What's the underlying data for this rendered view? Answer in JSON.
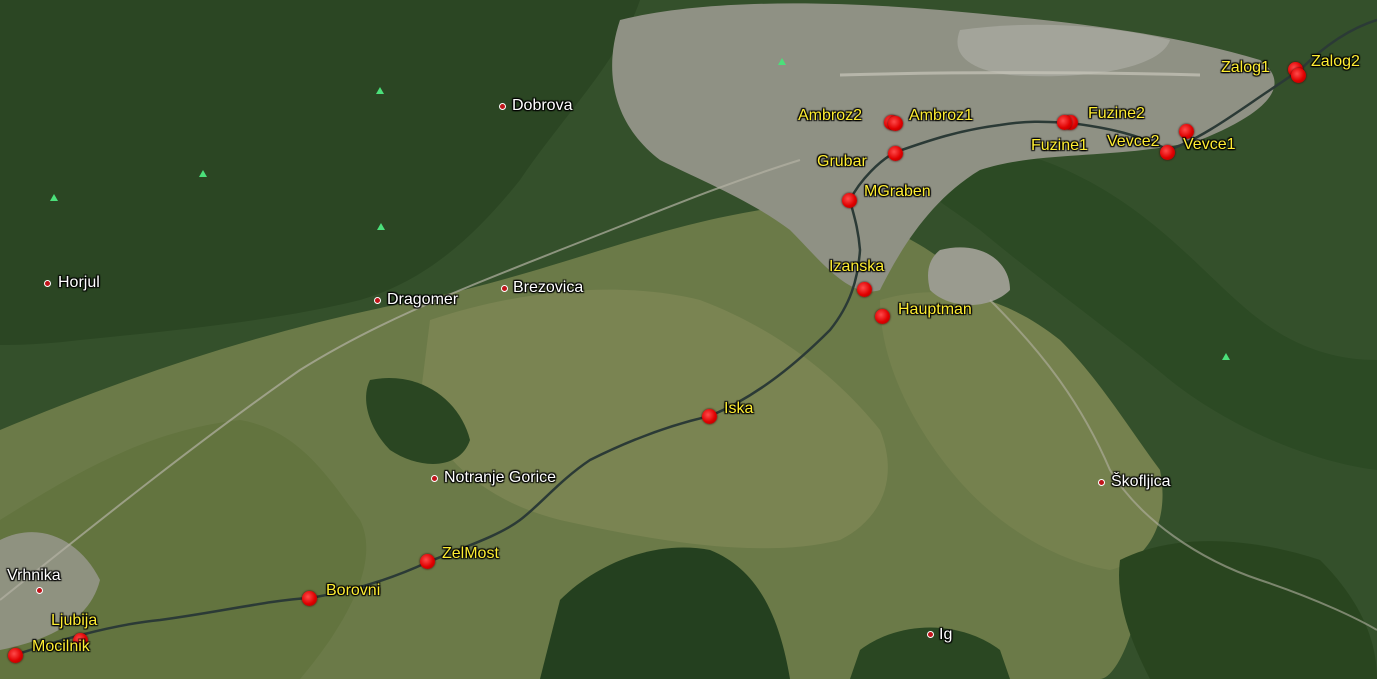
{
  "map": {
    "colors": {
      "forest": "#2f4a26",
      "fields": "#6f7d4c",
      "urban": "#9a9a8c",
      "river": "#2b3a36",
      "station": "#e00000",
      "station_label": "#ffee33",
      "town_label": "#ffffff"
    },
    "towns": [
      {
        "id": "dobrova",
        "name": "Dobrova"
      },
      {
        "id": "horjul",
        "name": "Horjul"
      },
      {
        "id": "dragomer",
        "name": "Dragomer"
      },
      {
        "id": "brezovica",
        "name": "Brezovica"
      },
      {
        "id": "notranje-gorice",
        "name": "Notranje Gorice"
      },
      {
        "id": "vrhnika",
        "name": "Vrhnika"
      },
      {
        "id": "ig",
        "name": "Ig"
      },
      {
        "id": "skofljica",
        "name": "Škofljica"
      }
    ],
    "stations": [
      {
        "id": "zalog1",
        "name": "Zalog1"
      },
      {
        "id": "zalog2",
        "name": "Zalog2"
      },
      {
        "id": "ambroz2",
        "name": "Ambroz2"
      },
      {
        "id": "ambroz1",
        "name": "Ambroz1"
      },
      {
        "id": "fuzine2",
        "name": "Fuzine2"
      },
      {
        "id": "fuzine1",
        "name": "Fuzine1"
      },
      {
        "id": "vevce2",
        "name": "Vevce2"
      },
      {
        "id": "vevce1",
        "name": "Vevce1"
      },
      {
        "id": "grubar",
        "name": "Grubar"
      },
      {
        "id": "mgraben",
        "name": "MGraben"
      },
      {
        "id": "izanska",
        "name": "Izanska"
      },
      {
        "id": "hauptman",
        "name": "Hauptman"
      },
      {
        "id": "iska",
        "name": "Iska"
      },
      {
        "id": "zelmost",
        "name": "ZelMost"
      },
      {
        "id": "borovni",
        "name": "Borovni"
      },
      {
        "id": "ljubija",
        "name": "Ljubija"
      },
      {
        "id": "mocilnik",
        "name": "Mocilnik"
      }
    ]
  }
}
